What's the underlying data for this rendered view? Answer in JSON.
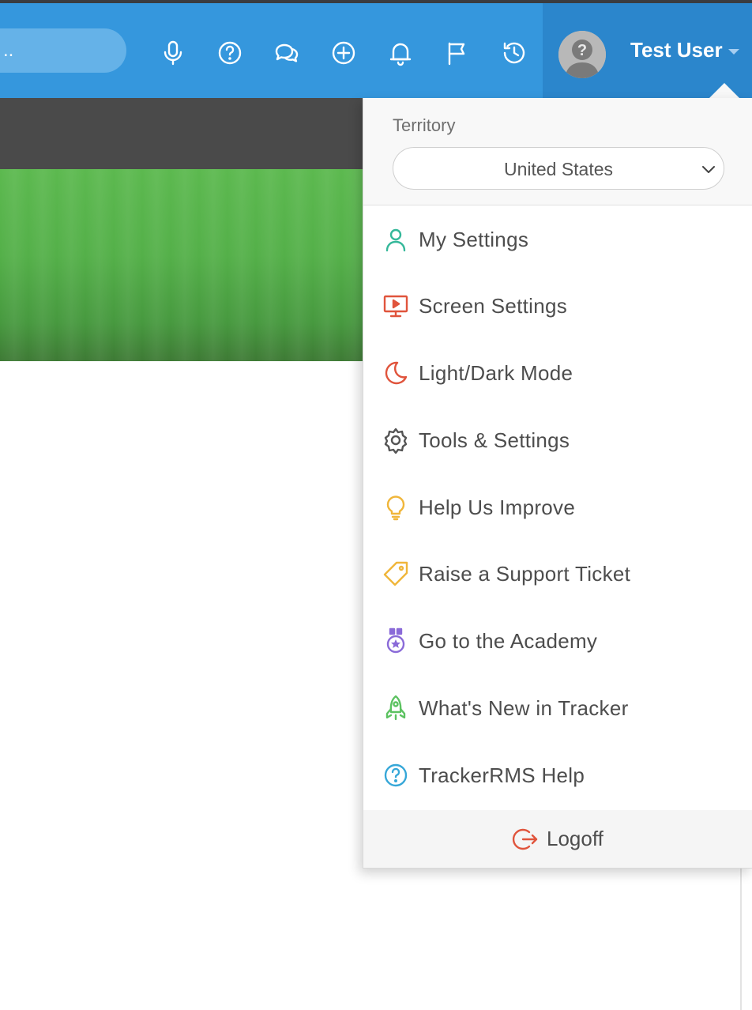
{
  "topbar": {
    "search_text": "..",
    "icons": [
      "microphone-icon",
      "help-circle-icon",
      "chat-bubbles-icon",
      "add-circle-icon",
      "bell-icon",
      "flag-icon",
      "history-icon"
    ],
    "user_name": "Test User"
  },
  "dropdown": {
    "territory_label": "Territory",
    "territory_value": "United States",
    "items": [
      {
        "label": "My Settings",
        "icon": "user-icon",
        "color": "#35b89a"
      },
      {
        "label": "Screen Settings",
        "icon": "monitor-play-icon",
        "color": "#e0543c"
      },
      {
        "label": "Light/Dark Mode",
        "icon": "moon-icon",
        "color": "#e0543c"
      },
      {
        "label": "Tools & Settings",
        "icon": "gear-icon",
        "color": "#555555"
      },
      {
        "label": "Help Us Improve",
        "icon": "lightbulb-icon",
        "color": "#f0b63a"
      },
      {
        "label": "Raise a Support Ticket",
        "icon": "tag-icon",
        "color": "#f0b63a"
      },
      {
        "label": "Go to the Academy",
        "icon": "medal-icon",
        "color": "#8a6ad8"
      },
      {
        "label": "What's New in Tracker",
        "icon": "rocket-icon",
        "color": "#5cc261"
      },
      {
        "label": "TrackerRMS Help",
        "icon": "help-circle-icon",
        "color": "#36a7d8"
      }
    ],
    "logoff_label": "Logoff"
  },
  "colors": {
    "topbar": "#3597dd",
    "user_area": "#2b86cc",
    "dark_band": "#4a4a4a",
    "hero_green": "#54b049",
    "logoff_red": "#e0543c"
  }
}
